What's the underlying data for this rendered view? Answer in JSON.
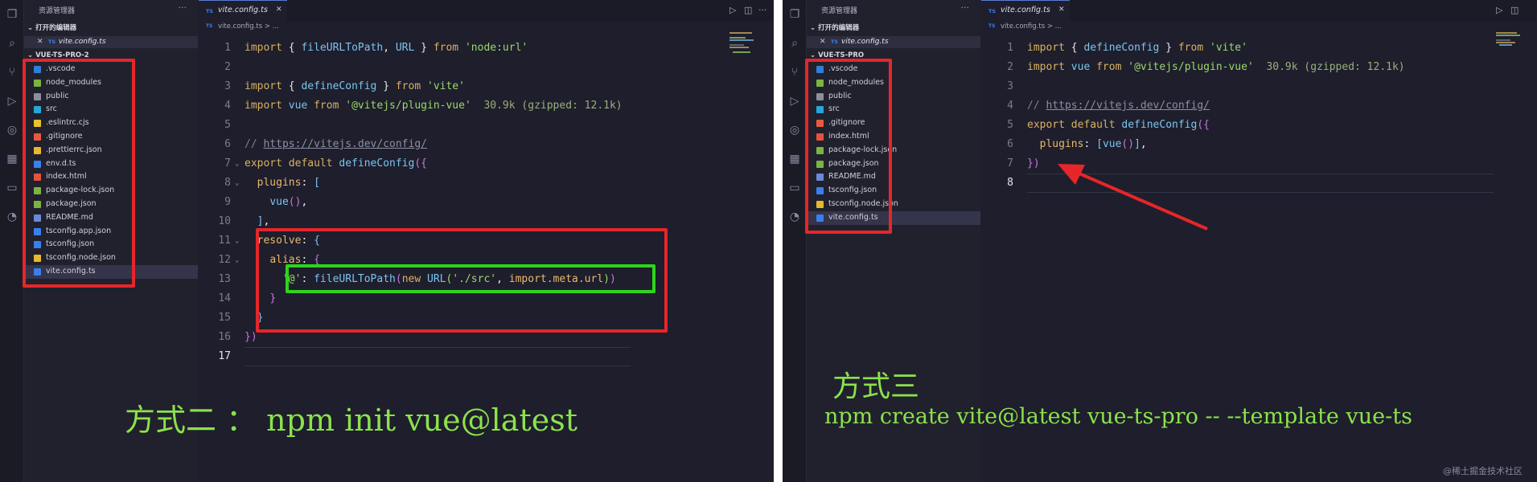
{
  "panels": [
    {
      "explorer_title": "资源管理器",
      "open_editors_label": "打开的编辑器",
      "open_file": "vite.config.ts",
      "project_label": "VUE-TS-PRO-2",
      "files": [
        {
          "name": ".vscode",
          "icon": "vscode-folder-icon",
          "color": "#2f7fd8"
        },
        {
          "name": "node_modules",
          "icon": "node-folder-icon",
          "color": "#7cb342"
        },
        {
          "name": "public",
          "icon": "folder-icon",
          "color": "#8d8d9e"
        },
        {
          "name": "src",
          "icon": "src-folder-icon",
          "color": "#27a6d8"
        },
        {
          "name": ".eslintrc.cjs",
          "icon": "eslint-icon",
          "color": "#e8c22e"
        },
        {
          "name": ".gitignore",
          "icon": "git-icon",
          "color": "#e85a3c"
        },
        {
          "name": ".prettierrc.json",
          "icon": "json-icon",
          "color": "#e8b82e"
        },
        {
          "name": "env.d.ts",
          "icon": "ts-icon",
          "color": "#3a7ff0"
        },
        {
          "name": "index.html",
          "icon": "html-icon",
          "color": "#e5533c"
        },
        {
          "name": "package-lock.json",
          "icon": "nodejs-icon",
          "color": "#7cb342"
        },
        {
          "name": "package.json",
          "icon": "nodejs-icon",
          "color": "#7cb342"
        },
        {
          "name": "README.md",
          "icon": "info-icon",
          "color": "#6a8ad8"
        },
        {
          "name": "tsconfig.app.json",
          "icon": "tsconfig-icon",
          "color": "#3a7ff0"
        },
        {
          "name": "tsconfig.json",
          "icon": "tsconfig-icon",
          "color": "#3a7ff0"
        },
        {
          "name": "tsconfig.node.json",
          "icon": "json-icon",
          "color": "#e8b82e"
        },
        {
          "name": "vite.config.ts",
          "icon": "tsconfig-icon",
          "color": "#3a7ff0",
          "selected": true
        }
      ],
      "tab": {
        "name": "vite.config.ts",
        "icon_text": "TS"
      },
      "breadcrumb": "vite.config.ts > ...",
      "cursor_line": 17,
      "code": [
        {
          "n": "1",
          "fold": "",
          "seg": [
            [
              "k",
              "import "
            ],
            [
              "p",
              "{ "
            ],
            [
              "f",
              "fileURLToPath"
            ],
            [
              "p",
              ", "
            ],
            [
              "f",
              "URL"
            ],
            [
              "p",
              " } "
            ],
            [
              "k",
              "from "
            ],
            [
              "s",
              "'node:url'"
            ]
          ]
        },
        {
          "n": "2",
          "fold": "",
          "seg": []
        },
        {
          "n": "3",
          "fold": "",
          "seg": [
            [
              "k",
              "import "
            ],
            [
              "p",
              "{ "
            ],
            [
              "f",
              "defineConfig"
            ],
            [
              "p",
              " } "
            ],
            [
              "k",
              "from "
            ],
            [
              "s",
              "'vite'"
            ]
          ]
        },
        {
          "n": "4",
          "fold": "",
          "seg": [
            [
              "k",
              "import "
            ],
            [
              "f",
              "vue "
            ],
            [
              "k",
              "from "
            ],
            [
              "s",
              "'@vitejs/plugin-vue'"
            ],
            [
              "sz",
              "  30.9k (gzipped: 12.1k)"
            ]
          ]
        },
        {
          "n": "5",
          "fold": "",
          "seg": []
        },
        {
          "n": "6",
          "fold": "",
          "seg": [
            [
              "c",
              "// "
            ],
            [
              "url",
              "https://vitejs.dev/config/"
            ]
          ]
        },
        {
          "n": "7",
          "fold": "⌄",
          "seg": [
            [
              "k",
              "export default "
            ],
            [
              "f",
              "defineConfig"
            ],
            [
              "b",
              "({"
            ]
          ]
        },
        {
          "n": "8",
          "fold": "⌄",
          "seg": [
            [
              "p",
              "  "
            ],
            [
              "t",
              "plugins"
            ],
            [
              "p",
              ": "
            ],
            [
              "f",
              "["
            ]
          ]
        },
        {
          "n": "9",
          "fold": "",
          "seg": [
            [
              "p",
              "    "
            ],
            [
              "f",
              "vue"
            ],
            [
              "b",
              "()"
            ],
            [
              "p",
              ","
            ]
          ]
        },
        {
          "n": "10",
          "fold": "",
          "seg": [
            [
              "p",
              "  "
            ],
            [
              "f",
              "]"
            ],
            [
              "p",
              ","
            ]
          ]
        },
        {
          "n": "11",
          "fold": "⌄",
          "seg": [
            [
              "p",
              "  "
            ],
            [
              "t",
              "resolve"
            ],
            [
              "p",
              ": "
            ],
            [
              "f",
              "{"
            ]
          ]
        },
        {
          "n": "12",
          "fold": "⌄",
          "seg": [
            [
              "p",
              "    "
            ],
            [
              "t",
              "alias"
            ],
            [
              "p",
              ": "
            ],
            [
              "b",
              "{"
            ]
          ]
        },
        {
          "n": "13",
          "fold": "",
          "seg": [
            [
              "p",
              "      "
            ],
            [
              "s",
              "'@'"
            ],
            [
              "p",
              ": "
            ],
            [
              "f",
              "fileURLToPath"
            ],
            [
              "b",
              "("
            ],
            [
              "k",
              "new "
            ],
            [
              "f",
              "URL"
            ],
            [
              "g",
              "("
            ],
            [
              "s",
              "'./src'"
            ],
            [
              "p",
              ", "
            ],
            [
              "t",
              "import.meta.url"
            ],
            [
              "g",
              ")"
            ],
            [
              "b",
              ")"
            ]
          ]
        },
        {
          "n": "14",
          "fold": "",
          "seg": [
            [
              "p",
              "    "
            ],
            [
              "b",
              "}"
            ]
          ]
        },
        {
          "n": "15",
          "fold": "",
          "seg": [
            [
              "p",
              "  "
            ],
            [
              "f",
              "}"
            ]
          ]
        },
        {
          "n": "16",
          "fold": "",
          "seg": [
            [
              "b",
              "})"
            ]
          ]
        },
        {
          "n": "17",
          "fold": "",
          "seg": []
        }
      ],
      "caption_lines": [
        "方式二 ： npm init vue@latest"
      ]
    },
    {
      "explorer_title": "资源管理器",
      "open_editors_label": "打开的编辑器",
      "open_file": "vite.config.ts",
      "project_label": "VUE-TS-PRO",
      "files": [
        {
          "name": ".vscode",
          "icon": "vscode-folder-icon",
          "color": "#2f7fd8"
        },
        {
          "name": "node_modules",
          "icon": "node-folder-icon",
          "color": "#7cb342"
        },
        {
          "name": "public",
          "icon": "folder-icon",
          "color": "#8d8d9e"
        },
        {
          "name": "src",
          "icon": "src-folder-icon",
          "color": "#27a6d8"
        },
        {
          "name": ".gitignore",
          "icon": "git-icon",
          "color": "#e85a3c"
        },
        {
          "name": "index.html",
          "icon": "html-icon",
          "color": "#e5533c"
        },
        {
          "name": "package-lock.json",
          "icon": "nodejs-icon",
          "color": "#7cb342"
        },
        {
          "name": "package.json",
          "icon": "nodejs-icon",
          "color": "#7cb342"
        },
        {
          "name": "README.md",
          "icon": "info-icon",
          "color": "#6a8ad8"
        },
        {
          "name": "tsconfig.json",
          "icon": "tsconfig-icon",
          "color": "#3a7ff0"
        },
        {
          "name": "tsconfig.node.json",
          "icon": "json-icon",
          "color": "#e8b82e"
        },
        {
          "name": "vite.config.ts",
          "icon": "tsconfig-icon",
          "color": "#3a7ff0",
          "selected": true
        }
      ],
      "tab": {
        "name": "vite.config.ts",
        "icon_text": "TS"
      },
      "breadcrumb": "vite.config.ts > ...",
      "cursor_line": 8,
      "code": [
        {
          "n": "1",
          "fold": "",
          "seg": [
            [
              "k",
              "import "
            ],
            [
              "p",
              "{ "
            ],
            [
              "f",
              "defineConfig"
            ],
            [
              "p",
              " } "
            ],
            [
              "k",
              "from "
            ],
            [
              "s",
              "'vite'"
            ]
          ]
        },
        {
          "n": "2",
          "fold": "",
          "seg": [
            [
              "k",
              "import "
            ],
            [
              "f",
              "vue "
            ],
            [
              "k",
              "from "
            ],
            [
              "s",
              "'@vitejs/plugin-vue'"
            ],
            [
              "sz",
              "  30.9k (gzipped: 12.1k)"
            ]
          ]
        },
        {
          "n": "3",
          "fold": "",
          "seg": []
        },
        {
          "n": "4",
          "fold": "",
          "seg": [
            [
              "c",
              "// "
            ],
            [
              "url",
              "https://vitejs.dev/config/"
            ]
          ]
        },
        {
          "n": "5",
          "fold": "",
          "seg": [
            [
              "k",
              "export default "
            ],
            [
              "f",
              "defineConfig"
            ],
            [
              "b",
              "({"
            ]
          ]
        },
        {
          "n": "6",
          "fold": "",
          "seg": [
            [
              "p",
              "  "
            ],
            [
              "t",
              "plugins"
            ],
            [
              "p",
              ": "
            ],
            [
              "f",
              "["
            ],
            [
              "f",
              "vue"
            ],
            [
              "b",
              "()"
            ],
            [
              "f",
              "]"
            ],
            [
              "p",
              ","
            ]
          ]
        },
        {
          "n": "7",
          "fold": "",
          "seg": [
            [
              "b",
              "})"
            ]
          ]
        },
        {
          "n": "8",
          "fold": "",
          "seg": []
        }
      ],
      "caption_lines": [
        "方式三",
        "npm create vite@latest vue-ts-pro -- --template vue-ts"
      ]
    }
  ],
  "watermark": "@稀土掘金技术社区",
  "colors": {
    "highlight_red": "#e5262a",
    "highlight_green": "#2ed41c",
    "caption": "#8ce24a",
    "arrow": "#e5262a"
  }
}
